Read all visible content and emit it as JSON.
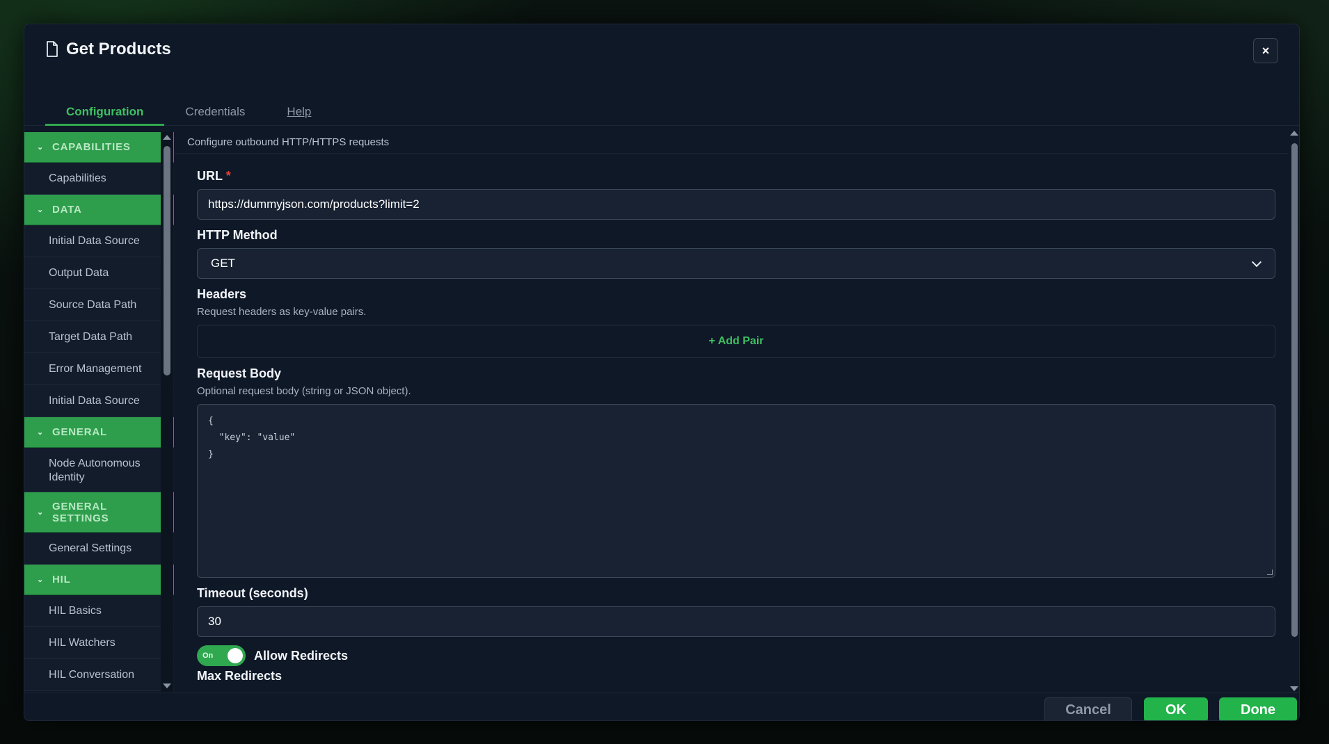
{
  "dialog": {
    "title": "Get Products",
    "close_label": "×",
    "icon": "document-icon"
  },
  "tabs": [
    {
      "label": "Configuration",
      "active": true
    },
    {
      "label": "Credentials",
      "active": false
    },
    {
      "label": "Help",
      "active": false
    }
  ],
  "sidebar": {
    "sections": [
      {
        "label": "CAPABILITIES",
        "items": [
          "Capabilities"
        ]
      },
      {
        "label": "DATA",
        "items": [
          "Initial Data Source",
          "Output Data",
          "Source Data Path",
          "Target Data Path",
          "Error Management",
          "Initial Data Source"
        ]
      },
      {
        "label": "GENERAL",
        "items": [
          "Node Autonomous Identity"
        ]
      },
      {
        "label": "GENERAL SETTINGS",
        "items": [
          "General Settings"
        ]
      },
      {
        "label": "HIL",
        "items": [
          "HIL Basics",
          "HIL Watchers",
          "HIL Conversation"
        ]
      }
    ]
  },
  "content": {
    "description": "Configure outbound HTTP/HTTPS requests",
    "url": {
      "label": "URL",
      "required_mark": "*",
      "value": "https://dummyjson.com/products?limit=2"
    },
    "method": {
      "label": "HTTP Method",
      "value": "GET"
    },
    "headers": {
      "label": "Headers",
      "help": "Request headers as key-value pairs.",
      "add_label": "+ Add Pair"
    },
    "body": {
      "label": "Request Body",
      "help": "Optional request body (string or JSON object).",
      "value": "{\n  \"key\": \"value\"\n}"
    },
    "timeout": {
      "label": "Timeout (seconds)",
      "value": "30"
    },
    "redirects": {
      "toggle_label": "On",
      "label": "Allow Redirects",
      "enabled": true
    },
    "max_redirects": {
      "label": "Max Redirects"
    }
  },
  "footer": {
    "cancel": "Cancel",
    "ok": "OK",
    "done": "Done"
  },
  "colors": {
    "accent": "#22b34b",
    "section_bg": "#2e9e4c",
    "panel_bg": "#0f1827",
    "required": "#e0433d"
  }
}
